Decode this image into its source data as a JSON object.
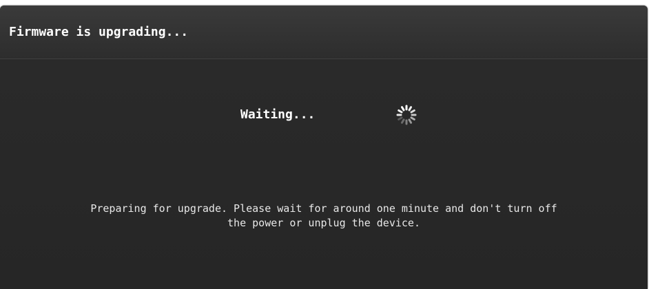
{
  "dialog": {
    "title": "Firmware is upgrading...",
    "status_label": "Waiting...",
    "spinner_icon": "loading-spinner-icon",
    "message_line1": "Preparing for upgrade. Please wait for around one minute and don't turn off",
    "message_line2": "the power or unplug the device."
  },
  "colors": {
    "background": "#2b2b2b",
    "text": "#ffffff"
  }
}
